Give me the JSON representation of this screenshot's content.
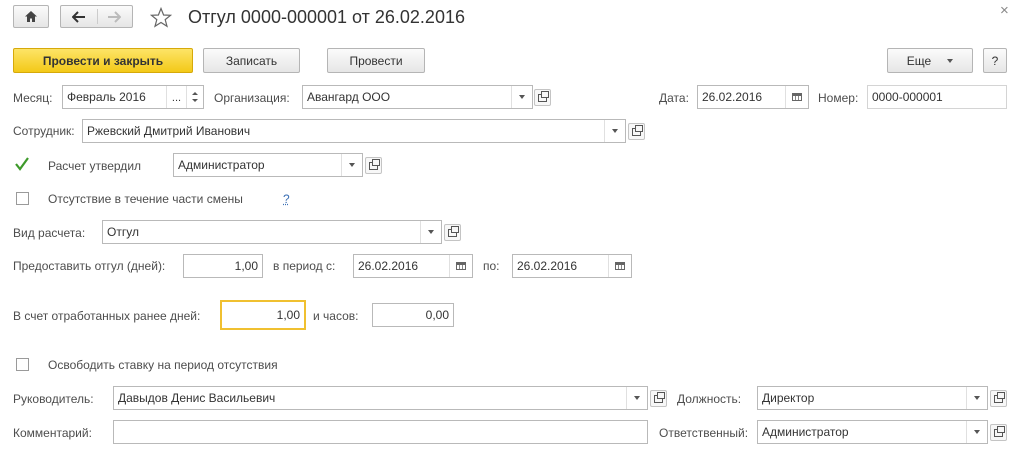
{
  "window": {
    "title": "Отгул 0000-000001 от 26.02.2016",
    "close_glyph": "×"
  },
  "icons": {
    "home": "home-icon",
    "back": "arrow-left-icon",
    "forward": "arrow-right-icon",
    "favorite": "star-icon",
    "close": "close-icon"
  },
  "toolbar": {
    "post_and_close": "Провести и закрыть",
    "save": "Записать",
    "post": "Провести",
    "more": "Еще",
    "help": "?"
  },
  "form": {
    "month_label": "Месяц:",
    "month_value": "Февраль 2016",
    "month_select": "...",
    "org_label": "Организация:",
    "org_value": "Авангард ООО",
    "date_label": "Дата:",
    "date_value": "26.02.2016",
    "number_label": "Номер:",
    "number_value": "0000-000001",
    "employee_label": "Сотрудник:",
    "employee_value": "Ржевский Дмитрий Иванович",
    "approved_label": "Расчет утвердил",
    "approved_checked": true,
    "approved_value": "Администратор",
    "partial_label": "Отсутствие в течение части смены",
    "partial_checked": false,
    "partial_help": "?",
    "calc_type_label": "Вид расчета:",
    "calc_type_value": "Отгул",
    "grant_days_label": "Предоставить отгул (дней):",
    "grant_days_value": "1,00",
    "period_from_label": "в период с:",
    "period_from_value": "26.02.2016",
    "period_to_label": "по:",
    "period_to_value": "26.02.2016",
    "worked_days_label": "В счет отработанных ранее дней:",
    "worked_days_value": "1,00",
    "hours_label": "и часов:",
    "hours_value": "0,00",
    "release_label": "Освободить ставку на период отсутствия",
    "release_checked": false,
    "manager_label": "Руководитель:",
    "manager_value": "Давыдов Денис Васильевич",
    "position_label": "Должность:",
    "position_value": "Директор",
    "comment_label": "Комментарий:",
    "comment_value": "",
    "responsible_label": "Ответственный:",
    "responsible_value": "Администратор"
  },
  "colors": {
    "primary_button": "#f3c918",
    "focus_border": "#f0c030",
    "check_mark": "#3e9a2b",
    "help_link": "#3a6fb5"
  }
}
